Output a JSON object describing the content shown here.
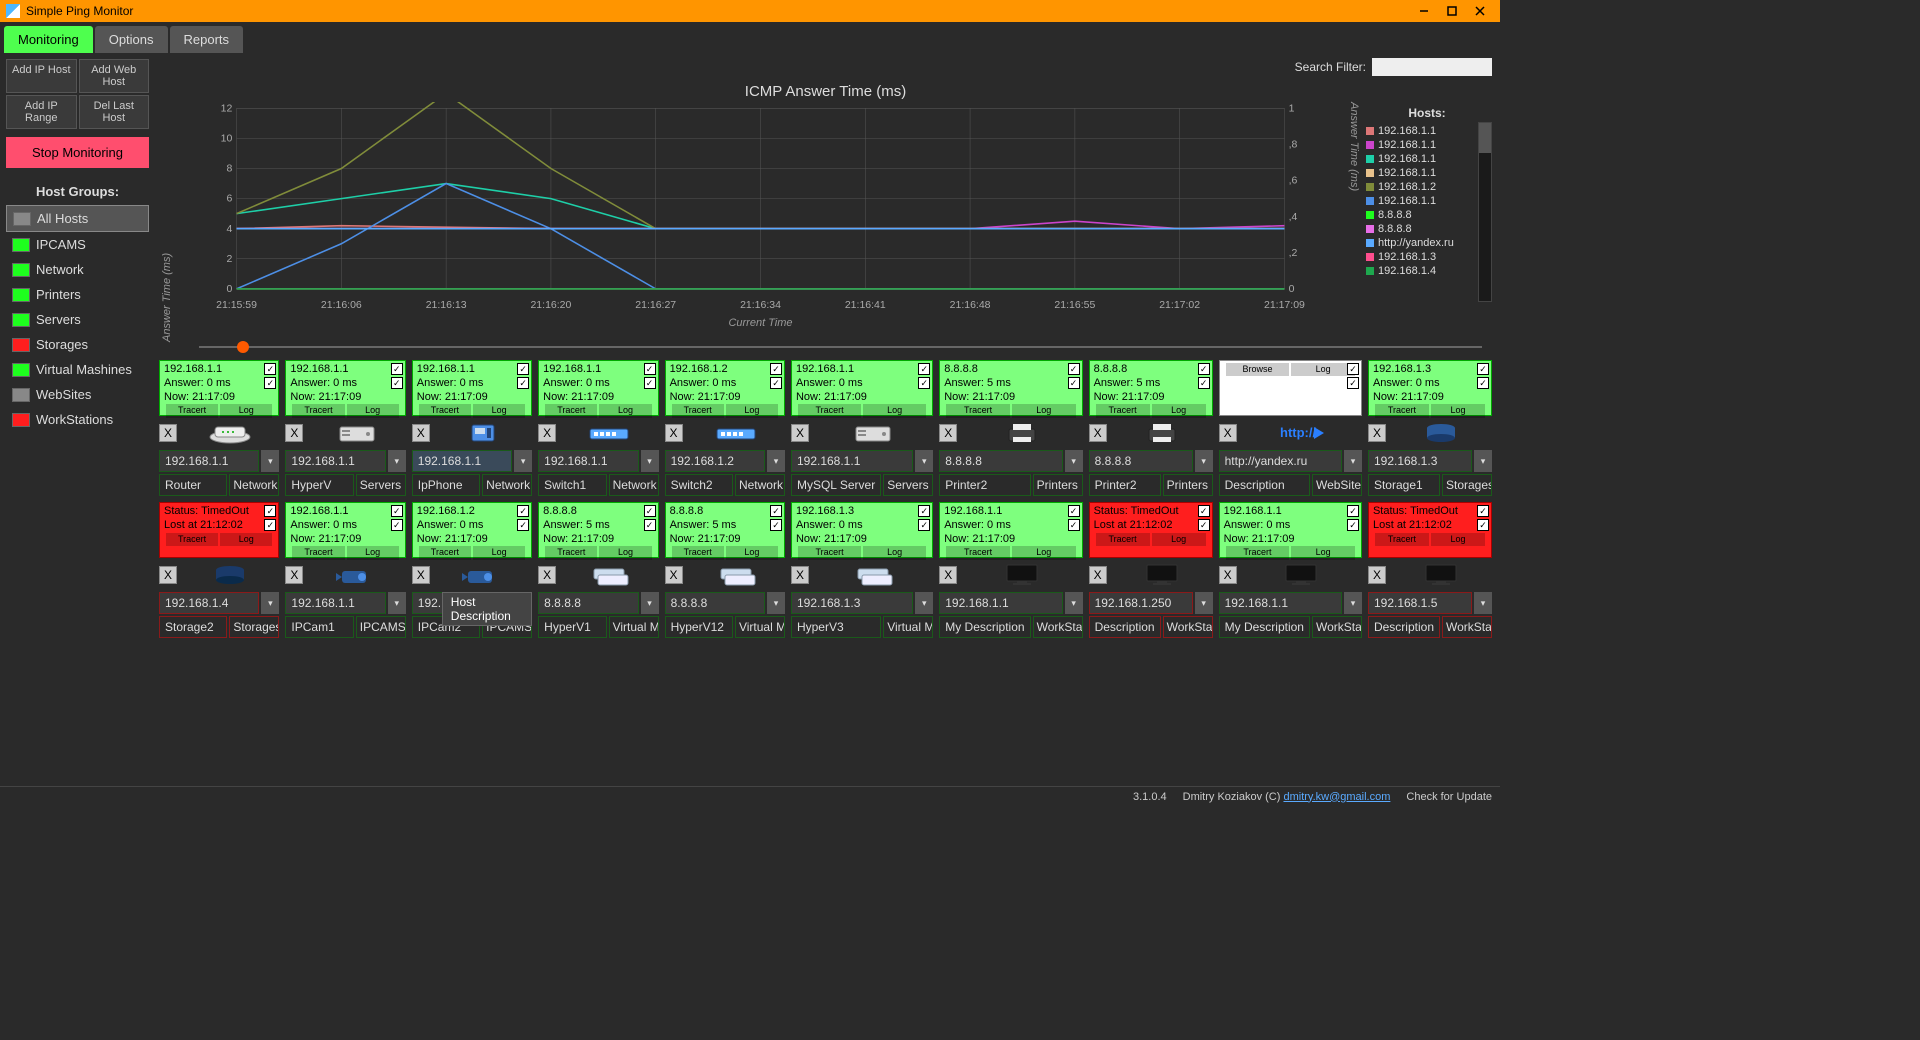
{
  "window": {
    "title": "Simple Ping Monitor"
  },
  "tabs": [
    {
      "label": "Monitoring",
      "active": true
    },
    {
      "label": "Options",
      "active": false
    },
    {
      "label": "Reports",
      "active": false
    }
  ],
  "sidebar_buttons": [
    [
      "Add IP Host",
      "Add Web Host"
    ],
    [
      "Add IP Range",
      "Del Last Host"
    ]
  ],
  "stop_label": "Stop Monitoring",
  "groups_header": "Host Groups:",
  "groups": [
    {
      "label": "All Hosts",
      "color": "gray",
      "active": true
    },
    {
      "label": "IPCAMS",
      "color": "green"
    },
    {
      "label": "Network",
      "color": "green"
    },
    {
      "label": "Printers",
      "color": "green"
    },
    {
      "label": "Servers",
      "color": "green"
    },
    {
      "label": "Storages",
      "color": "red"
    },
    {
      "label": "Virtual Mashines",
      "color": "green"
    },
    {
      "label": "WebSites",
      "color": "gray"
    },
    {
      "label": "WorkStations",
      "color": "red"
    }
  ],
  "search_label": "Search Filter:",
  "chart_data": {
    "type": "line",
    "title": "ICMP Answer Time (ms)",
    "xlabel": "Current Time",
    "ylabel": "Answer Time (ms)",
    "y2label": "Answer Time (ms)",
    "ylim": [
      0,
      12
    ],
    "y2lim": [
      0,
      1
    ],
    "yticks": [
      0,
      2,
      4,
      6,
      8,
      10,
      12
    ],
    "y2ticks": [
      0,
      0.2,
      0.4,
      0.6,
      0.8,
      1
    ],
    "x": [
      "21:15:59",
      "21:16:06",
      "21:16:13",
      "21:16:20",
      "21:16:27",
      "21:16:34",
      "21:16:41",
      "21:16:48",
      "21:16:55",
      "21:17:02",
      "21:17:09"
    ],
    "series": [
      {
        "name": "192.168.1.1",
        "color": "#d77",
        "values": [
          4,
          4.2,
          4.1,
          4,
          4,
          4,
          4,
          4,
          4,
          4,
          4
        ]
      },
      {
        "name": "192.168.1.1",
        "color": "#c4c",
        "values": [
          4,
          4,
          4,
          4,
          4,
          4,
          4,
          4,
          4.5,
          4,
          4.2
        ]
      },
      {
        "name": "192.168.1.1",
        "color": "#1ecfa8",
        "values": [
          5,
          6,
          7,
          6,
          4,
          4,
          4,
          4,
          4,
          4,
          4
        ]
      },
      {
        "name": "192.168.1.1",
        "color": "#e8c28c",
        "values": [
          4,
          4,
          4,
          4,
          4,
          4,
          4,
          4,
          4,
          4,
          4
        ]
      },
      {
        "name": "192.168.1.2",
        "color": "#808c3a",
        "values": [
          5,
          8,
          13,
          8,
          4,
          4,
          4,
          4,
          4,
          4,
          4
        ]
      },
      {
        "name": "192.168.1.1",
        "color": "#4d8fe6",
        "values": [
          0,
          3,
          7,
          4,
          0,
          0,
          0,
          0,
          0,
          0,
          0
        ]
      },
      {
        "name": "8.8.8.8",
        "color": "#1eff1e",
        "values": [
          0,
          0,
          0,
          0,
          0,
          0,
          0,
          0,
          0,
          0,
          0
        ]
      },
      {
        "name": "8.8.8.8",
        "color": "#e86ee8",
        "values": [
          4,
          4,
          4,
          4,
          4,
          4,
          4,
          4,
          4,
          4,
          4
        ]
      },
      {
        "name": "http://yandex.ru",
        "color": "#5aaaff",
        "values": [
          4,
          4,
          4,
          4,
          4,
          4,
          4,
          4,
          4,
          4,
          4
        ]
      },
      {
        "name": "192.168.1.3",
        "color": "#ff4e8e",
        "values": [
          0,
          0,
          0,
          0,
          0,
          0,
          0,
          0,
          0,
          0,
          0
        ]
      },
      {
        "name": "192.168.1.4",
        "color": "#1ea84e",
        "values": [
          0,
          0,
          0,
          0,
          0,
          0,
          0,
          0,
          0,
          0,
          0
        ]
      }
    ]
  },
  "legend_header": "Hosts:",
  "tracert_label": "Tracert",
  "log_label": "Log",
  "browse_label": "Browse",
  "tooltip_text": "Host Description",
  "hosts": [
    {
      "status": "green",
      "ip": "192.168.1.1",
      "answer": "0 ms",
      "now": "21:17:09",
      "desc": "Router",
      "group": "Network",
      "icon": "router",
      "tint": "g"
    },
    {
      "status": "green",
      "ip": "192.168.1.1",
      "answer": "0 ms",
      "now": "21:17:09",
      "desc": "HyperV",
      "group": "Servers",
      "icon": "server",
      "tint": "g"
    },
    {
      "status": "green",
      "ip": "192.168.1.1",
      "answer": "0 ms",
      "now": "21:17:09",
      "desc": "IpPhone",
      "group": "Network",
      "icon": "phone",
      "tint": "g",
      "sel": true
    },
    {
      "status": "green",
      "ip": "192.168.1.1",
      "answer": "0 ms",
      "now": "21:17:09",
      "desc": "Switch1",
      "group": "Network",
      "icon": "switch",
      "tint": "g"
    },
    {
      "status": "green",
      "ip": "192.168.1.2",
      "answer": "0 ms",
      "now": "21:17:09",
      "desc": "Switch2",
      "group": "Network",
      "icon": "switch",
      "tint": "g"
    },
    {
      "status": "green",
      "ip": "192.168.1.1",
      "answer": "0 ms",
      "now": "21:17:09",
      "desc": "MySQL Server",
      "group": "Servers",
      "icon": "server",
      "tint": "g"
    },
    {
      "status": "green",
      "ip": "8.8.8.8",
      "answer": "5 ms",
      "now": "21:17:09",
      "desc": "Printer2",
      "group": "Printers",
      "icon": "printer",
      "tint": "g"
    },
    {
      "status": "green",
      "ip": "8.8.8.8",
      "answer": "5 ms",
      "now": "21:17:09",
      "desc": "Printer2",
      "group": "Printers",
      "icon": "printer",
      "tint": "g"
    },
    {
      "status": "white",
      "ip": "http://yandex.ru",
      "answer": "",
      "now": "",
      "desc": "Description",
      "group": "WebSites",
      "icon": "http",
      "tint": "g",
      "browse": true
    },
    {
      "status": "green",
      "ip": "192.168.1.3",
      "answer": "0 ms",
      "now": "21:17:09",
      "desc": "Storage1",
      "group": "Storages",
      "icon": "storage",
      "tint": "g"
    },
    {
      "status": "red",
      "ip": "192.168.1.4",
      "errline1": "Status: TimedOut",
      "errline2": "Lost at 21:12:02",
      "desc": "Storage2",
      "group": "Storages",
      "icon": "storage2",
      "tint": "r"
    },
    {
      "status": "green",
      "ip": "192.168.1.1",
      "answer": "0 ms",
      "now": "21:17:09",
      "desc": "IPCam1",
      "group": "IPCAMS",
      "icon": "cam",
      "tint": "g"
    },
    {
      "status": "green",
      "ip": "192.168.1.2",
      "answer": "0 ms",
      "now": "21:17:09",
      "desc": "IPCam2",
      "group": "IPCAMS",
      "icon": "cam",
      "tint": "g",
      "show_tooltip": true
    },
    {
      "status": "green",
      "ip": "8.8.8.8",
      "answer": "5 ms",
      "now": "21:17:09",
      "desc": "HyperV1",
      "group": "Virtual Mashines",
      "icon": "vm",
      "tint": "g"
    },
    {
      "status": "green",
      "ip": "8.8.8.8",
      "answer": "5 ms",
      "now": "21:17:09",
      "desc": "HyperV12",
      "group": "Virtual Mashines",
      "icon": "vm",
      "tint": "g"
    },
    {
      "status": "green",
      "ip": "192.168.1.3",
      "answer": "0 ms",
      "now": "21:17:09",
      "desc": "HyperV3",
      "group": "Virtual Mashines",
      "icon": "vm",
      "tint": "g"
    },
    {
      "status": "green",
      "ip": "192.168.1.1",
      "answer": "0 ms",
      "now": "21:17:09",
      "desc": "My Description",
      "group": "WorkStations",
      "icon": "monitor",
      "tint": "g"
    },
    {
      "status": "red",
      "ip": "192.168.1.250",
      "errline1": "Status: TimedOut",
      "errline2": "Lost at 21:12:02",
      "desc": "Description",
      "group": "WorkStations",
      "icon": "monitor",
      "tint": "r"
    },
    {
      "status": "green",
      "ip": "192.168.1.1",
      "answer": "0 ms",
      "now": "21:17:09",
      "desc": "My Description",
      "group": "WorkStations",
      "icon": "monitor",
      "tint": "g"
    },
    {
      "status": "red",
      "ip": "192.168.1.5",
      "errline1": "Status: TimedOut",
      "errline2": "Lost at 21:12:02",
      "desc": "Description",
      "group": "WorkStations",
      "icon": "monitor",
      "tint": "r"
    }
  ],
  "footer": {
    "version": "3.1.0.4",
    "copyright": "Dmitry Koziakov (C) ",
    "email": "dmitry.kw@gmail.com",
    "update": "Check for Update"
  }
}
